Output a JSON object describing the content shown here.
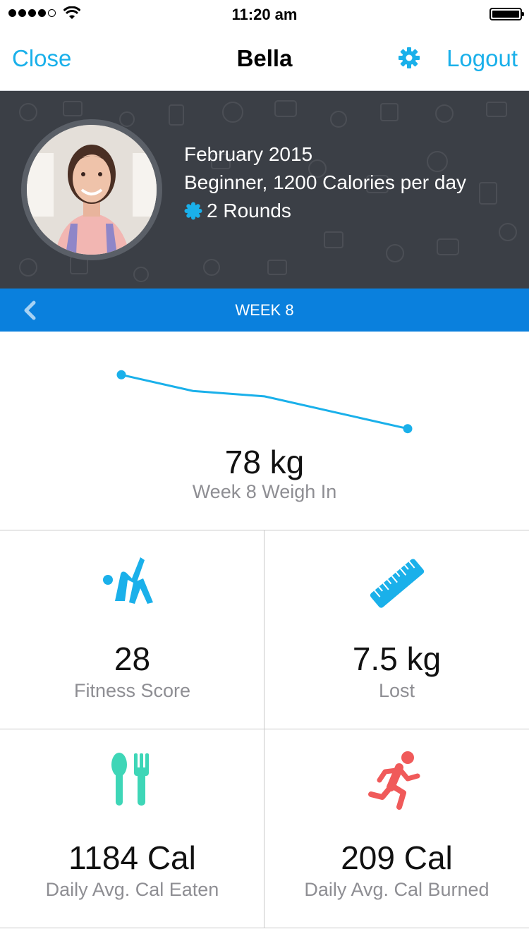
{
  "status_bar": {
    "time": "11:20 am",
    "signal_bars_filled": 4,
    "signal_bars_total": 5
  },
  "nav": {
    "close_label": "Close",
    "title": "Bella",
    "settings_icon": "gear-icon",
    "logout_label": "Logout",
    "accent_color": "#1ab0ea"
  },
  "profile": {
    "month": "February 2015",
    "plan": "Beginner, 1200 Calories per day",
    "rounds": "2 Rounds",
    "background_color": "#3b3f46"
  },
  "week": {
    "label": "WEEK 8",
    "bar_color": "#0a80dd"
  },
  "weigh_in": {
    "value": "78 kg",
    "label": "Week 8 Weigh In"
  },
  "chart_data": {
    "type": "line",
    "series": [
      {
        "values": [
          83,
          81.5,
          81,
          79.5,
          78
        ]
      }
    ],
    "x": [
      1,
      2,
      3,
      4,
      5
    ],
    "ylim": [
      77,
      84
    ],
    "grid": false,
    "color": "#1ab0ea"
  },
  "stats": [
    {
      "value": "28",
      "label": "Fitness Score",
      "icon": "stretching-person-icon",
      "color": "#1ab0ea"
    },
    {
      "value": "7.5 kg",
      "label": "Lost",
      "icon": "measuring-tape-icon",
      "color": "#1ab0ea"
    },
    {
      "value": "1184 Cal",
      "label": "Daily Avg. Cal Eaten",
      "icon": "spoon-fork-icon",
      "color": "#3ed6b7"
    },
    {
      "value": "209 Cal",
      "label": "Daily Avg. Cal Burned",
      "icon": "running-person-icon",
      "color": "#f05a5a"
    }
  ]
}
